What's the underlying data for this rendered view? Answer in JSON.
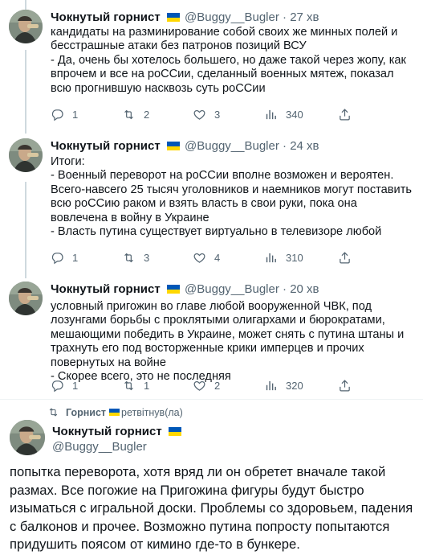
{
  "author": {
    "name": "Чокнутый горнист",
    "handle": "@Buggy__Bugler"
  },
  "tweets": [
    {
      "time": "27 хв",
      "text": "кандидаты на разминирование собой своих же минных полей и бесстрашные атаки без патронов позиций ВСУ\n- Да, очень бы хотелось большего, но даже такой через жопу, как впрочем и все на роССии, сделанный военных мятеж, показал всю прогнившую насквозь суть роССии",
      "replies": "1",
      "retweets": "2",
      "likes": "3",
      "views": "340"
    },
    {
      "time": "24 хв",
      "text": "Итоги:\n- Военный переворот на роССии вполне возможен и вероятен. Всего-навсего 25 тысяч уголовников и наемников могут поставить всю роССию раком и взять власть в свои руки, пока она вовлечена в войну в Украине\n- Власть путина существует виртуально в телевизоре любой",
      "replies": "1",
      "retweets": "3",
      "likes": "4",
      "views": "310"
    },
    {
      "time": "20 хв",
      "text": "условный пригожин во главе любой вооруженной ЧВК, под лозунгами борьбы с проклятыми олигархами и бюрократами, мешающими победить в Украине, может снять с путина штаны и трахнуть его под восторженные крики имперцев и прочих повернутых на войне\n- Скорее всего, это не последняя",
      "replies": "1",
      "retweets": "1",
      "likes": "2",
      "views": "320"
    }
  ],
  "retweet_bar": {
    "user": "Горнист",
    "label": "ретвітнув(ла)"
  },
  "retweeted": {
    "text": "попытка переворота, хотя вряд ли он обретет вначале такой размах. Все погожие на Пригожина фигуры будут быстро изыматься с игральной доски. Проблемы со здоровьем, падения с балконов и прочее. Возможно путина попросту попытаются придушить поясом от кимино где-то в бункере."
  },
  "dot": "·",
  "colors": {
    "flag_blue": "#0057b7",
    "flag_yellow": "#ffd700",
    "muted": "#536471",
    "divider": "#eff3f4"
  },
  "icons": [
    "reply-icon",
    "retweet-icon",
    "like-icon",
    "views-icon",
    "share-icon",
    "more-icon"
  ]
}
